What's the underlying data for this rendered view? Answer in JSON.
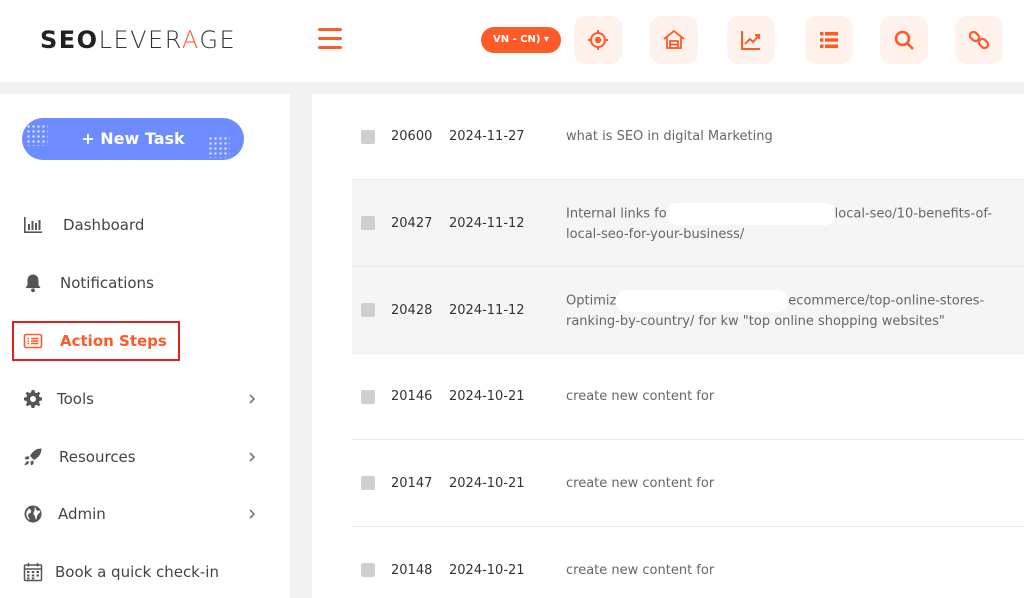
{
  "header": {
    "logo": {
      "part1": "SEO",
      "part2": "LEVER",
      "accent": "A",
      "part3": "GE"
    },
    "lang_label": "VN - CN) ▾",
    "icons": [
      "target-icon",
      "house-icon",
      "trend-chart-icon",
      "list-icon",
      "search-icon",
      "link-icon"
    ]
  },
  "sidebar": {
    "new_task_label": "+ New Task",
    "items": [
      {
        "label": "Dashboard",
        "icon": "bar-chart-icon",
        "has_chevron": false
      },
      {
        "label": "Notifications",
        "icon": "bell-icon",
        "has_chevron": false
      },
      {
        "label": "Action Steps",
        "icon": "list-card-icon",
        "has_chevron": false,
        "active": true
      },
      {
        "label": "Tools",
        "icon": "gear-icon",
        "has_chevron": true
      },
      {
        "label": "Resources",
        "icon": "rocket-icon",
        "has_chevron": true
      },
      {
        "label": "Admin",
        "icon": "globe-icon",
        "has_chevron": true
      },
      {
        "label": "Book a quick check-in",
        "icon": "calendar-icon",
        "has_chevron": false
      }
    ]
  },
  "tasks": [
    {
      "id": "20600",
      "date": "2024-11-27",
      "title_a": "what is SEO in digital Marketing",
      "title_b": ""
    },
    {
      "id": "20427",
      "date": "2024-11-12",
      "title_a": "Internal links fo",
      "title_b": "local-seo/10-benefits-of-local-seo-for-your-business/"
    },
    {
      "id": "20428",
      "date": "2024-11-12",
      "title_a": "Optimiz",
      "title_b": "ecommerce/top-online-stores-ranking-by-country/ for kw \"top online shopping websites\""
    },
    {
      "id": "20146",
      "date": "2024-10-21",
      "title_a": "create new content for",
      "title_b": ""
    },
    {
      "id": "20147",
      "date": "2024-10-21",
      "title_a": "create new content for",
      "title_b": ""
    },
    {
      "id": "20148",
      "date": "2024-10-21",
      "title_a": "create new content for",
      "title_b": ""
    }
  ],
  "colors": {
    "accent": "#ff5b29",
    "new_task_bg": "#6c8cff",
    "highlight": "#e0221f"
  }
}
